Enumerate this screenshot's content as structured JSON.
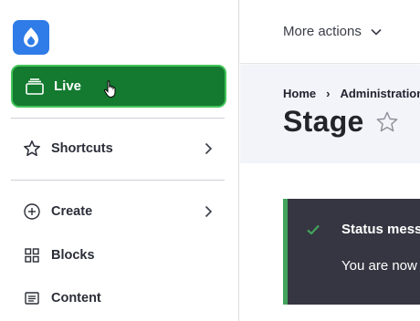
{
  "sidebar": {
    "logo_icon": "drupal-drop-icon",
    "workspace_button": {
      "label": "Live",
      "icon": "workspace-icon",
      "color": "#137a2f"
    },
    "items": [
      {
        "label": "Shortcuts",
        "icon": "star-icon",
        "has_submenu": true
      },
      {
        "label": "Create",
        "icon": "plus-circle-icon",
        "has_submenu": true
      },
      {
        "label": "Blocks",
        "icon": "blocks-grid-icon",
        "has_submenu": false
      },
      {
        "label": "Content",
        "icon": "content-list-icon",
        "has_submenu": false
      }
    ]
  },
  "topbar": {
    "more_actions_label": "More actions"
  },
  "breadcrumb": {
    "items": [
      "Home",
      "Administration"
    ],
    "separator": "›"
  },
  "page": {
    "title": "Stage"
  },
  "status_message": {
    "title": "Status message",
    "body": "You are now viewing Stage",
    "accent_color": "#42a35b"
  }
}
